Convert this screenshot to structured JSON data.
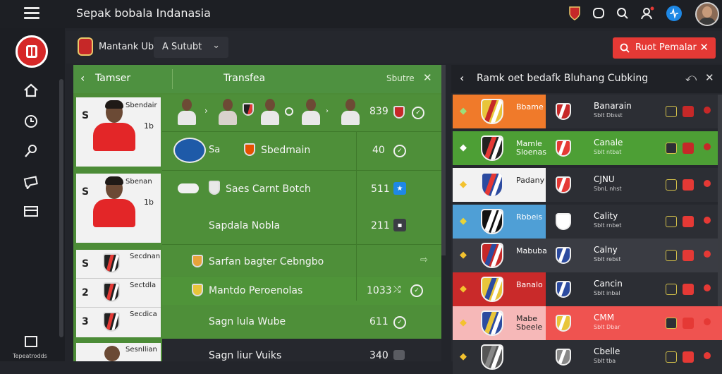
{
  "app": {
    "title": "Sepak bobala Indanasia"
  },
  "topbar": {
    "icons": [
      "club-badge-icon",
      "chat-bubble-icon",
      "search-icon",
      "user-alert-icon",
      "activity-icon",
      "user-avatar"
    ]
  },
  "sidebar": {
    "items": [
      "home-icon",
      "clock-icon",
      "search-icon",
      "message-icon",
      "wallet-icon"
    ],
    "bottom_label": "Tepeatrodds"
  },
  "subheader": {
    "club_name": "Mantank Ubo",
    "dropdown_value": "A Sutubt",
    "promo_label": "Ruot Pemalar"
  },
  "left_panel": {
    "back": "‹",
    "title_left": "Tamser",
    "title_center": "Transfea",
    "title_right": "Sbutre",
    "cards": [
      {
        "num": "S",
        "name": "Sbendair",
        "value": "1b"
      },
      {
        "num": "S",
        "name": "Sbenan",
        "value": "1b"
      },
      {
        "num": "S",
        "name": "Secdnan",
        "value": ""
      },
      {
        "num": "2",
        "name": "Sectdla",
        "value": ""
      },
      {
        "num": "3",
        "name": "Secdica",
        "value": ""
      },
      {
        "num": "",
        "name": "Sesnllian",
        "value": ""
      }
    ],
    "rows": [
      {
        "text": "",
        "stat": "839"
      },
      {
        "text": "Sbedmain",
        "stat": "40"
      },
      {
        "text": "Saes Carnt Botch",
        "stat": "511"
      },
      {
        "text": "Sapdala  Nobla",
        "stat": "211"
      },
      {
        "text": "Sarfan bagter Cebngbo",
        "stat": ""
      },
      {
        "text": "Mantdo Peroenolas",
        "stat": "1033"
      },
      {
        "text": "Sagn lula  Wube",
        "stat": "611"
      },
      {
        "text": "Sagn liur  Vuiks",
        "stat": "340"
      }
    ],
    "row1_extra": "Sa"
  },
  "right_panel": {
    "back": "‹",
    "title": "Ramk oet bedafk Bluhang Cubking",
    "rows": [
      {
        "name": "Bbame",
        "opp": "Banarain",
        "opp_sub": "Sblt Dbsst",
        "bg": "#f07a2a",
        "row_bg": "#2c2e34",
        "tri": "#9be07a",
        "c1": "#e8c53a",
        "c2": "#c62828",
        "status": "#c62828",
        "status_bg": "#2d2f35"
      },
      {
        "name": "Mamle Sloenas",
        "opp": "Canale",
        "opp_sub": "Sblt ntbat",
        "bg": "#4d9f35",
        "row_bg": "#4d9f35",
        "tri": "#ffffff",
        "c1": "#222222",
        "c2": "#e53935",
        "status": "#c62828",
        "status_bg": "#4d9f35"
      },
      {
        "name": "Padany",
        "opp": "CJNU",
        "opp_sub": "SbnL nhst",
        "bg": "#f2f2f2",
        "row_bg": "#2c2e34",
        "tri": "#f3c22f",
        "c1": "#2c4ba0",
        "c2": "#e53935",
        "status": "#e53935",
        "status_bg": "#2d2f35"
      },
      {
        "name": "Rbbeis",
        "opp": "Cality",
        "opp_sub": "Sblt rnbet",
        "bg": "#4f9fd6",
        "row_bg": "#2c2e34",
        "tri": "#e8d33a",
        "c1": "#111111",
        "c2": "#ffffff",
        "status": "#e53935",
        "status_bg": "#2d2f35"
      },
      {
        "name": "Mabuba",
        "opp": "Calny",
        "opp_sub": "Sblt rebst",
        "bg": "#3a3c43",
        "row_bg": "#3a3c43",
        "tri": "#f3c22f",
        "c1": "#c62828",
        "c2": "#2c4ba0",
        "status": "#e53935",
        "status_bg": "#3a3c43"
      },
      {
        "name": "Banalo",
        "opp": "Cancin",
        "opp_sub": "Sblt inbal",
        "bg": "#c92a2a",
        "row_bg": "#2c2e34",
        "tri": "#f3c22f",
        "c1": "#e8c53a",
        "c2": "#2c4ba0",
        "status": "#e53935",
        "status_bg": "#2d2f35"
      },
      {
        "name": "Mabe Sbeele",
        "opp": "CMM",
        "opp_sub": "Sblt Dbar",
        "bg": "#f6b8b8",
        "row_bg": "#ef5350",
        "tri": "#f3c22f",
        "c1": "#2c4ba0",
        "c2": "#e8c53a",
        "status": "#e53935",
        "status_bg": "#ef5350"
      },
      {
        "name": "",
        "opp": "Cbelle",
        "opp_sub": "Sblt tba",
        "bg": "#2c2e34",
        "row_bg": "#2c2e34",
        "tri": "#f3c22f",
        "c1": "#555555",
        "c2": "#888888",
        "status": "#e53935",
        "status_bg": "#2d2f35"
      }
    ]
  }
}
